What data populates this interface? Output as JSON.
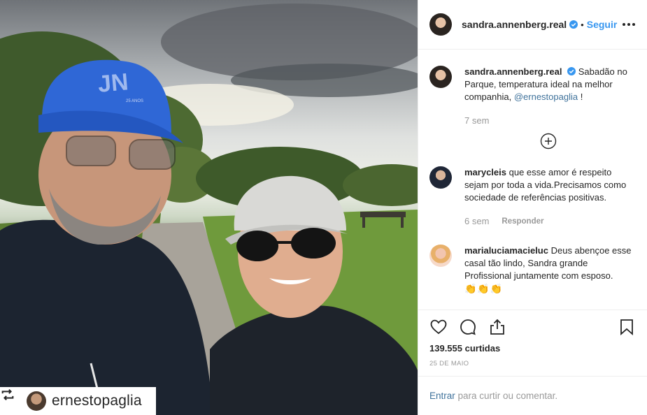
{
  "photo": {
    "cap_logo": "JN",
    "cap_subtext": "25 ANOS",
    "regram_user": "ernestopaglia"
  },
  "header": {
    "username": "sandra.annenberg.real",
    "separator": "•",
    "follow_label": "Seguir"
  },
  "caption": {
    "username": "sandra.annenberg.real",
    "text": "Sabadão no Parque, temperatura ideal na melhor companhia,",
    "mention": "@ernestopaglia",
    "suffix": " !",
    "time": "7 sem"
  },
  "comments": [
    {
      "username": "marycleis",
      "text": "que esse amor é respeito sejam por toda a vida.Precisamos como sociedade de referências positivas.",
      "time": "6 sem",
      "reply_label": "Responder"
    },
    {
      "username": "marialuciamacieluc",
      "text": "Deus abençoe esse casal tão lindo, Sandra grande Profissional juntamente com esposo.",
      "emojis": "👏👏👏"
    }
  ],
  "actions": {
    "likes": "139.555 curtidas",
    "date": "25 DE MAIO"
  },
  "add_comment": {
    "login_label": "Entrar",
    "rest": " para curtir ou comentar."
  },
  "colors": {
    "accent": "#3897f0",
    "link": "#3f729b",
    "muted": "#999999",
    "border": "#efefef"
  }
}
